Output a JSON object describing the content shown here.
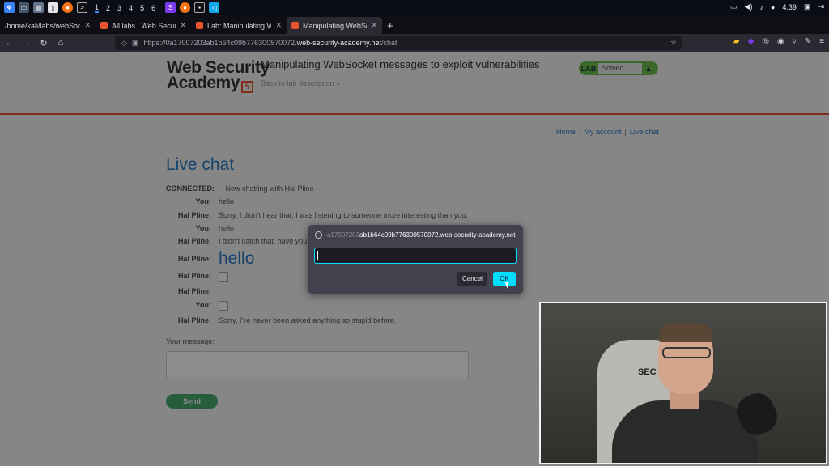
{
  "taskbar": {
    "workspaces": [
      "1",
      "2",
      "3",
      "4",
      "5",
      "6"
    ],
    "active_workspace": "1",
    "clock": "4:39"
  },
  "browser": {
    "tabs": [
      {
        "label": "/home/kali/labs/webSockets/",
        "active": false
      },
      {
        "label": "All labs | Web Security Ac",
        "active": false
      },
      {
        "label": "Lab: Manipulating WebSoc",
        "active": false
      },
      {
        "label": "Manipulating WebSocket",
        "active": true
      }
    ],
    "url_prefix": "https://0a17007203ab1b64c09b776300570072.",
    "url_host": "web-security-academy.net",
    "url_path": "/chat"
  },
  "header": {
    "logo_line1": "Web Security",
    "logo_line2": "Academy",
    "lab_title": "Manipulating WebSocket messages to exploit vulnerabilities",
    "back_link": "Back to lab description",
    "lab_badge": "LAB",
    "lab_status": "Solved"
  },
  "nav_links": [
    "Home",
    "My account",
    "Live chat"
  ],
  "chat": {
    "title": "Live chat",
    "rows": [
      {
        "who": "CONNECTED:",
        "msg": "-- Now chatting with Hal Pline --"
      },
      {
        "who": "You:",
        "msg": "hello"
      },
      {
        "who": "Hal Pline:",
        "msg": "Sorry, I didn't hear that, I was listening to someone more interesting than you."
      },
      {
        "who": "You:",
        "msg": "hello"
      },
      {
        "who": "Hal Pline:",
        "msg": "I didn't catch that, have you b"
      },
      {
        "who": "Hal Pline:",
        "msg": "hello"
      },
      {
        "who": "Hal Pline:",
        "msg": ""
      },
      {
        "who": "Hal Pline:",
        "msg": ""
      },
      {
        "who": "You:",
        "msg": ""
      },
      {
        "who": "Hal Pline:",
        "msg": "Sorry, I've never been asked anything so stupid before."
      }
    ],
    "your_message_label": "Your message:",
    "send_label": "Send"
  },
  "dialog": {
    "origin_faded": "a17007203",
    "origin": "ab1b64c09b776300570072.web-security-academy.net",
    "input_value": "",
    "cancel_label": "Cancel",
    "ok_label": "OK"
  },
  "webcam": {
    "chair_brand": "SEC"
  },
  "colors": {
    "accent": "#2979c4",
    "brand": "#e8542e",
    "ok_button": "#00ddff",
    "send_button": "#4aa96c"
  }
}
